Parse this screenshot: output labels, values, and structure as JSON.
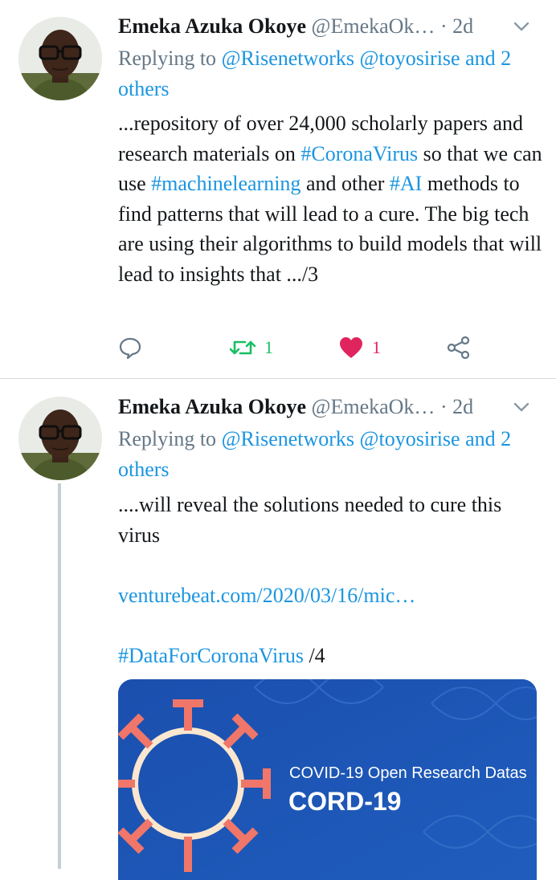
{
  "tweets": [
    {
      "author_name": "Emeka Azuka Okoye",
      "handle": "@EmekaOk…",
      "separator": "·",
      "time": "2d",
      "replying_prefix": "Replying to",
      "replying_mentions": "@Risenetworks @toyosirise and 2 others",
      "text_parts": [
        "...repository of over 24,000 scholarly papers and research materials on ",
        "#CoronaVirus",
        " so that we can use ",
        "#machinelearning",
        " and other ",
        "#AI",
        " methods to find patterns that will lead to a cure. The big tech are using their algorithms to build models that will lead to insights that .../3"
      ],
      "actions": {
        "reply_icon": "reply-icon",
        "retweet_icon": "retweet-icon",
        "retweet_count": "1",
        "like_icon": "heart-icon",
        "like_count": "1",
        "share_icon": "share-icon"
      }
    },
    {
      "author_name": "Emeka Azuka Okoye",
      "handle": "@EmekaOk…",
      "separator": "·",
      "time": "2d",
      "replying_prefix": "Replying to",
      "replying_mentions": "@Risenetworks @toyosirise and 2 others",
      "text_line": "....will reveal the solutions needed to cure this virus",
      "link": "venturebeat.com/2020/03/16/mic…",
      "hashtag": "#DataForCoronaVirus",
      "suffix": " /4",
      "card": {
        "subtitle": "COVID-19 Open Research Datas",
        "title": "CORD-19"
      }
    }
  ],
  "colors": {
    "link": "#1b95e0",
    "muted": "#657786",
    "retweet": "#17bf63",
    "like": "#e0245e",
    "card_bg": "#1d57b4",
    "virus": "#f0766a"
  }
}
